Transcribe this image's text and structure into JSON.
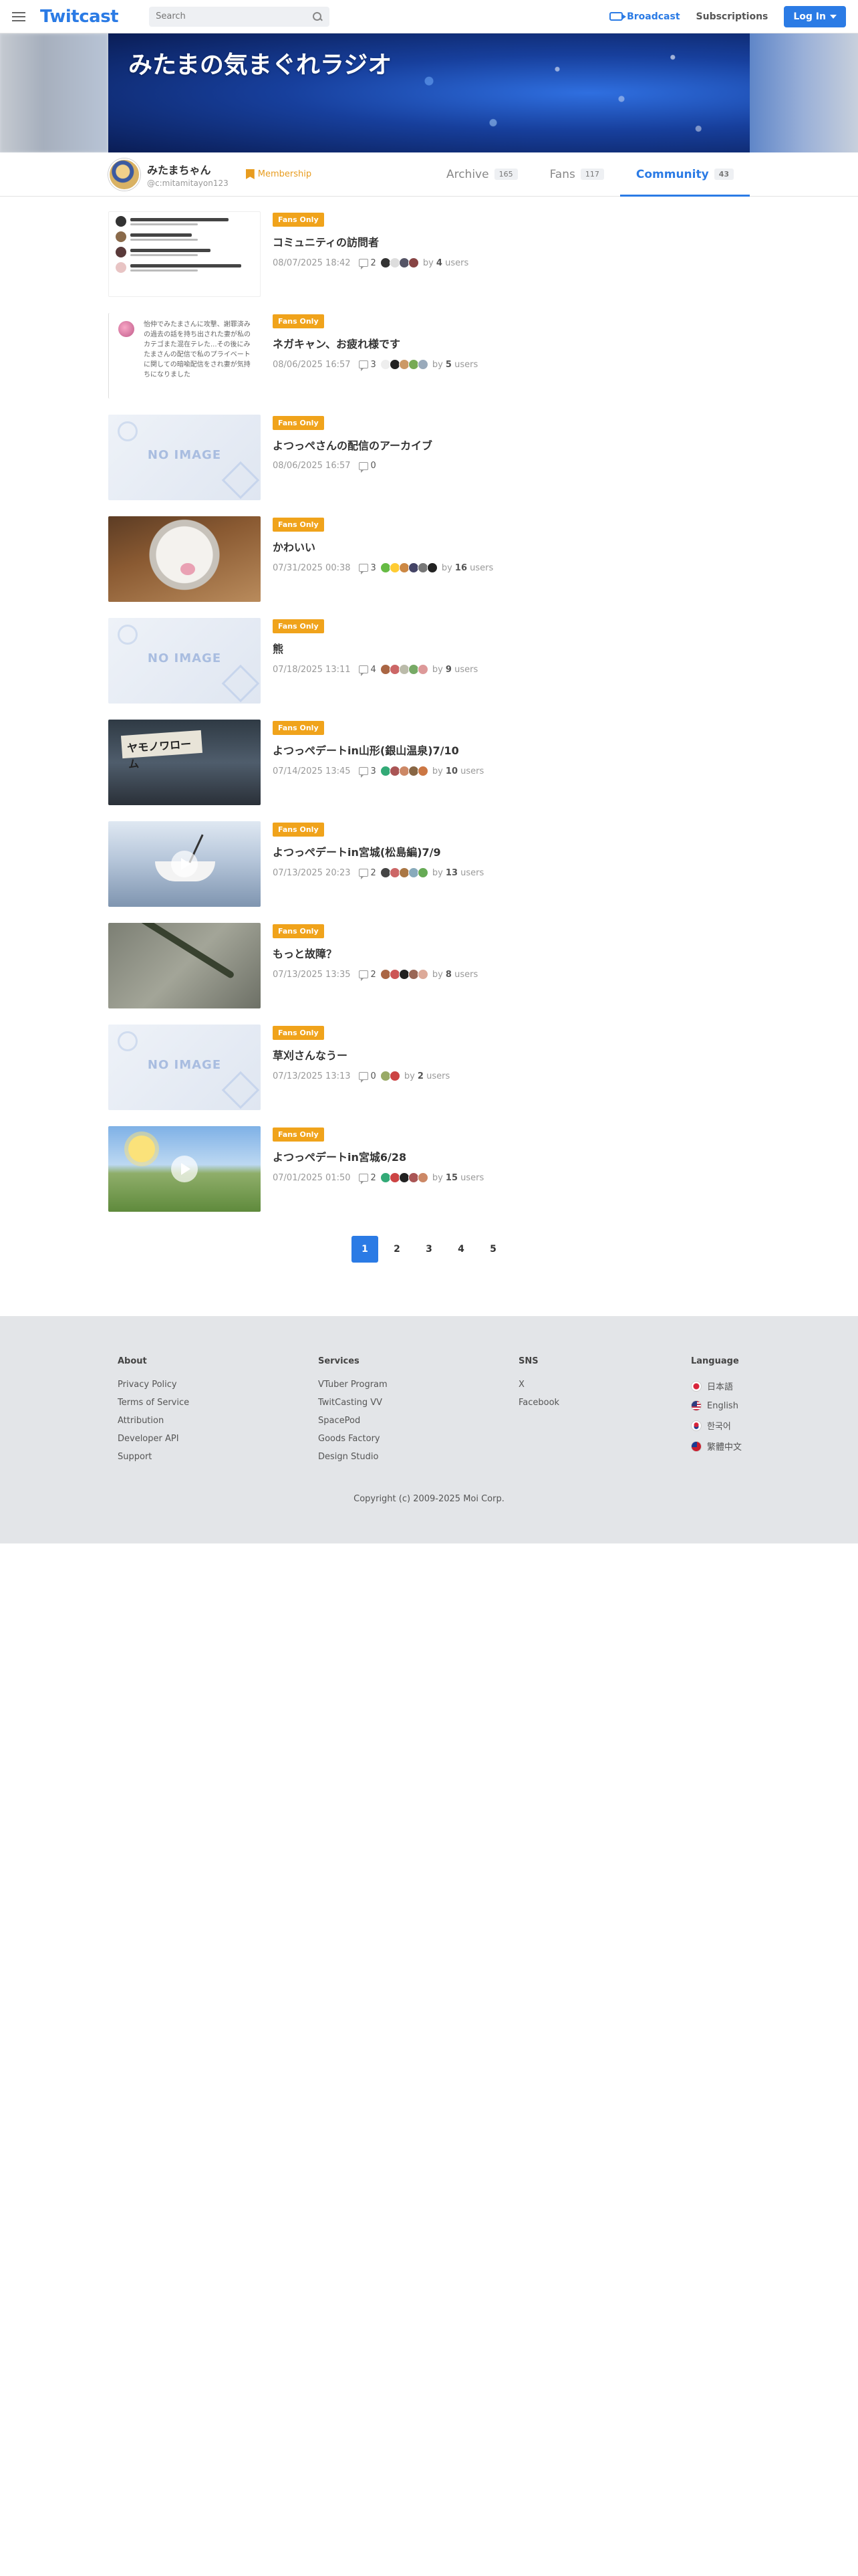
{
  "header": {
    "logo": "Twitcast",
    "search_placeholder": "Search",
    "broadcast_label": "Broadcast",
    "subscriptions_label": "Subscriptions",
    "login_label": "Log In"
  },
  "banner": {
    "title": "みたまの気まぐれラジオ"
  },
  "profile": {
    "name": "みたまちゃん",
    "handle": "@c:mitamitayon123",
    "membership_label": "Membership"
  },
  "tabs": [
    {
      "label": "Archive",
      "count": "165"
    },
    {
      "label": "Fans",
      "count": "117"
    },
    {
      "label": "Community",
      "count": "43"
    }
  ],
  "post_badge": "Fans Only",
  "posts": [
    {
      "title": "コミュニティの訪問者",
      "date": "08/07/2025 18:42",
      "comments": "2",
      "users": "4"
    },
    {
      "title": "ネガキャン、お疲れ様です",
      "date": "08/06/2025 16:57",
      "comments": "3",
      "users": "5"
    },
    {
      "title": "よつっぺさんの配信のアーカイブ",
      "date": "08/06/2025 16:57",
      "comments": "0",
      "users": ""
    },
    {
      "title": "かわいい",
      "date": "07/31/2025 00:38",
      "comments": "3",
      "users": "16"
    },
    {
      "title": "熊",
      "date": "07/18/2025 13:11",
      "comments": "4",
      "users": "9"
    },
    {
      "title": "よつっぺデートin山形(銀山温泉)7/10",
      "date": "07/14/2025 13:45",
      "comments": "3",
      "users": "10"
    },
    {
      "title": "よつっぺデートin宮城(松島編)7/9",
      "date": "07/13/2025 20:23",
      "comments": "2",
      "users": "13"
    },
    {
      "title": "もっと故障？",
      "date": "07/13/2025 13:35",
      "comments": "2",
      "users": "8"
    },
    {
      "title": "草刈さんなうー",
      "date": "07/13/2025 13:13",
      "comments": "0",
      "users": "2"
    },
    {
      "title": "よつっぺデートin宮城6/28",
      "date": "07/01/2025 01:50",
      "comments": "2",
      "users": "15"
    }
  ],
  "meta": {
    "by": "by",
    "users": "users"
  },
  "thumb_text": {
    "no_image": "NO IMAGE",
    "textpost": "怡仲でみたまさんに攻撃、謝罪済みの過去の話を持ち出された妻が私のカテゴまた混在テレた...その後にみたまさんの配信で私のプライベートに関しての暗喩配信をされ妻が気持ちになりました",
    "photo2_sign": "ヤモノワローム"
  },
  "pagination": [
    "1",
    "2",
    "3",
    "4",
    "5"
  ],
  "footer": {
    "about_heading": "About",
    "about_links": [
      "Privacy Policy",
      "Terms of Service",
      "Attribution",
      "Developer API",
      "Support"
    ],
    "services_heading": "Services",
    "services_links": [
      "VTuber Program",
      "TwitCasting VV",
      "SpacePod",
      "Goods Factory",
      "Design Studio"
    ],
    "sns_heading": "SNS",
    "sns_links": [
      "X",
      "Facebook"
    ],
    "language_heading": "Language",
    "languages": [
      "日本語",
      "English",
      "한국어",
      "繁體中文"
    ],
    "copyright": "Copyright (c) 2009-2025 Moi Corp."
  },
  "colors": {
    "accent": "#2b7be5",
    "badge": "#f0a31b"
  }
}
